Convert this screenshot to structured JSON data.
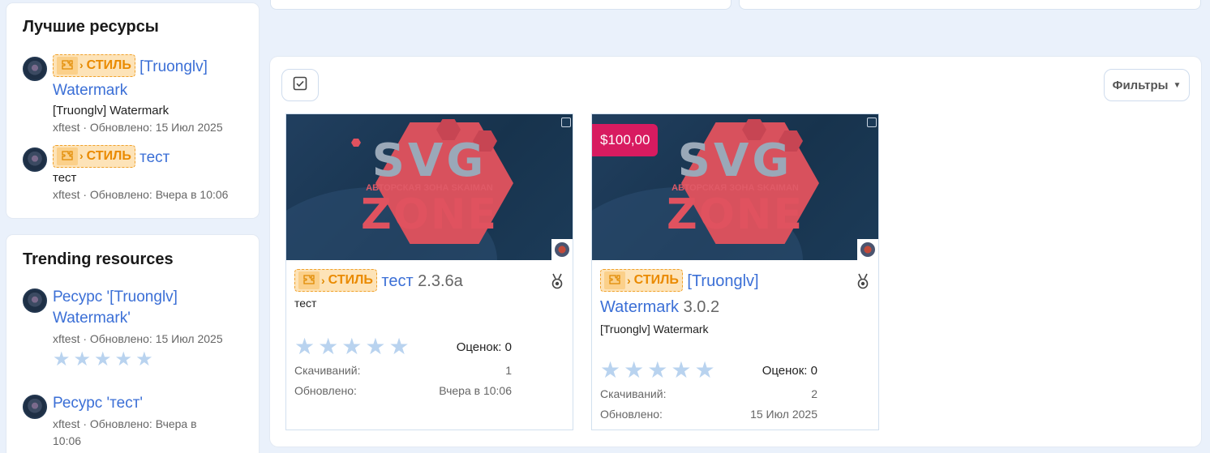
{
  "sidebar": {
    "best": {
      "title": "Лучшие ресурсы",
      "items": [
        {
          "badge": "СТИЛЬ",
          "link": "[Truonglv] Watermark",
          "tagline": "[Truonglv] Watermark",
          "meta": "xftest · Обновлено: 15 Июл 2025"
        },
        {
          "badge": "СТИЛЬ",
          "link": "тест",
          "tagline": "тест",
          "meta": "xftest · Обновлено: Вчера в 10:06"
        }
      ]
    },
    "trending": {
      "title": "Trending resources",
      "items": [
        {
          "link": "Ресурс '[Truonglv] Watermark'",
          "meta": "xftest · Обновлено: 15 Июл 2025",
          "rating": 0
        },
        {
          "link": "Ресурс 'тест'",
          "meta": "xftest · Обновлено: Вчера в 10:06"
        }
      ]
    }
  },
  "toolbar": {
    "filters_label": "Фильтры",
    "select_icon": "checkbox-icon",
    "caret_icon": "caret-down-icon"
  },
  "cards": [
    {
      "logo_text": "SVG",
      "logo_sub": "АВТОРСКАЯ ЗОНА SKAIMAN",
      "logo_text2": "ZONE",
      "badge": "СТИЛЬ",
      "title": "тест",
      "version": "2.3.6a",
      "tagline": "тест",
      "rating_label": "Оценок: 0",
      "downloads_label": "Скачиваний:",
      "downloads_value": "1",
      "updated_label": "Обновлено:",
      "updated_value": "Вчера в 10:06",
      "rating": 0
    },
    {
      "price": "$100,00",
      "logo_text": "SVG",
      "logo_sub": "АВТОРСКАЯ ЗОНА SKAIMAN",
      "logo_text2": "ZONE",
      "badge": "СТИЛЬ",
      "title_line1": "[Truonglv]",
      "title_line2": "Watermark",
      "version": "3.0.2",
      "tagline": "[Truonglv] Watermark",
      "rating_label": "Оценок: 0",
      "downloads_label": "Скачиваний:",
      "downloads_value": "2",
      "updated_label": "Обновлено:",
      "updated_value": "15 Июл 2025",
      "rating": 0
    }
  ],
  "colors": {
    "background": "#eaf1fb",
    "link": "#3b6fd6",
    "badge": "#ea8a00",
    "price": "#d81b60",
    "star_empty": "#b9d3ef"
  }
}
